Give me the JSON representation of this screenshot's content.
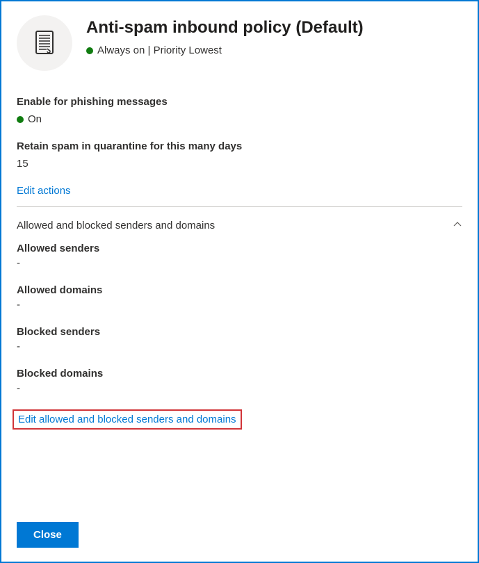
{
  "header": {
    "title": "Anti-spam inbound policy (Default)",
    "status": "Always on | Priority Lowest"
  },
  "fields": {
    "phishing_label": "Enable for phishing messages",
    "phishing_value": "On",
    "retain_label": "Retain spam in quarantine for this many days",
    "retain_value": "15"
  },
  "links": {
    "edit_actions": "Edit actions",
    "edit_allowed_blocked": "Edit allowed and blocked senders and domains"
  },
  "section": {
    "title": "Allowed and blocked senders and domains",
    "allowed_senders_label": "Allowed senders",
    "allowed_senders_value": "-",
    "allowed_domains_label": "Allowed domains",
    "allowed_domains_value": "-",
    "blocked_senders_label": "Blocked senders",
    "blocked_senders_value": "-",
    "blocked_domains_label": "Blocked domains",
    "blocked_domains_value": "-"
  },
  "buttons": {
    "close": "Close"
  }
}
